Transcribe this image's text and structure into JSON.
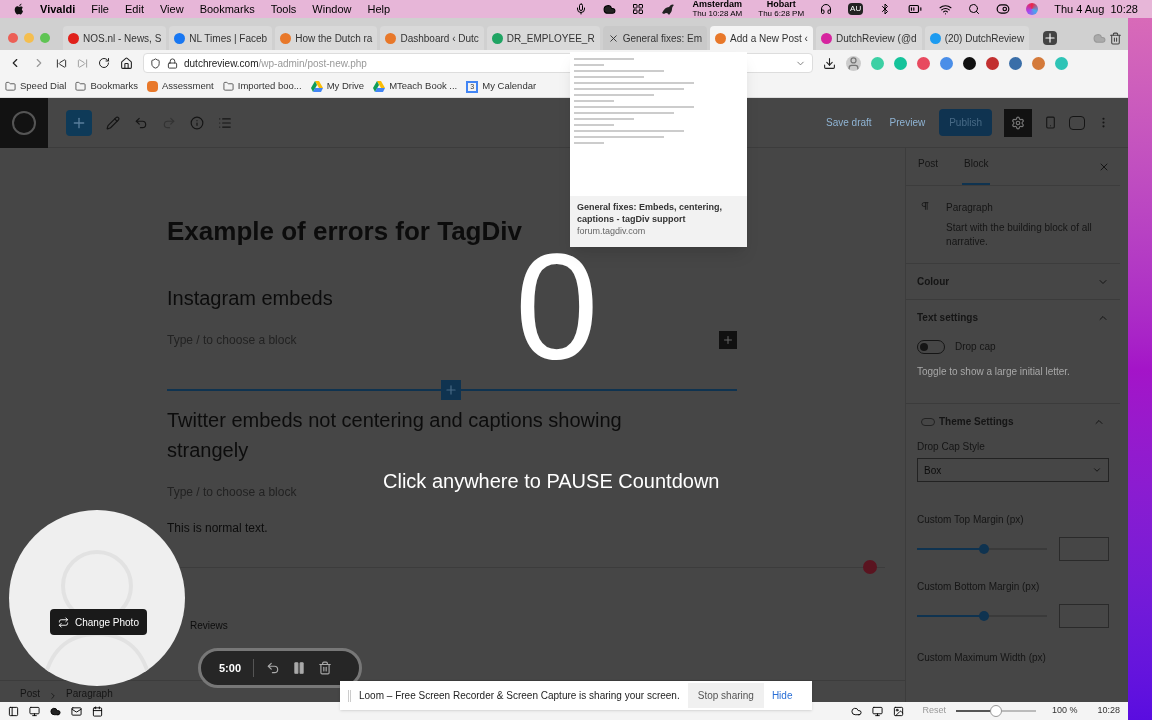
{
  "menu_bar": {
    "app": "Vivaldi",
    "items": [
      "File",
      "Edit",
      "View",
      "Bookmarks",
      "Tools",
      "Window",
      "Help"
    ],
    "clocks": [
      {
        "city": "Amsterdam",
        "time": "Thu 10:28 AM"
      },
      {
        "city": "Hobart",
        "time": "Thu 6:28 PM"
      }
    ],
    "input_source": "AU",
    "date": "Thu 4 Aug  10:28"
  },
  "tabs": [
    {
      "title": "NOS.nl - News, S",
      "selected": false,
      "hovered": false
    },
    {
      "title": "NL Times | Faceb",
      "selected": false,
      "hovered": false
    },
    {
      "title": "How the Dutch ra",
      "selected": false,
      "hovered": false
    },
    {
      "title": "Dashboard ‹ Dutc",
      "selected": false,
      "hovered": false
    },
    {
      "title": "DR_EMPLOYEE_R",
      "selected": false,
      "hovered": false
    },
    {
      "title": "General fixes: Em",
      "selected": false,
      "hovered": true
    },
    {
      "title": "Add a New Post ‹",
      "selected": true,
      "hovered": false
    },
    {
      "title": "DutchReview (@d",
      "selected": false,
      "hovered": false
    },
    {
      "title": "(20) DutchReview",
      "selected": false,
      "hovered": false
    }
  ],
  "address": {
    "host": "dutchreview.com",
    "path": "/wp-admin/post-new.php"
  },
  "bookmarks": [
    {
      "label": "Speed Dial",
      "kind": "folder"
    },
    {
      "label": "Bookmarks",
      "kind": "folder"
    },
    {
      "label": "Assessment",
      "kind": "site"
    },
    {
      "label": "Imported boo...",
      "kind": "folder"
    },
    {
      "label": "My Drive",
      "kind": "drive"
    },
    {
      "label": "MTeach Book ...",
      "kind": "drive"
    },
    {
      "label": "My Calendar",
      "kind": "calendar"
    }
  ],
  "calendar_day": "3",
  "wp_toolbar": {
    "save_draft": "Save draft",
    "preview": "Preview",
    "publish": "Publish"
  },
  "editor": {
    "title": "Example of errors for TagDiv",
    "blocks": [
      {
        "kind": "heading",
        "text": "Instagram embeds"
      },
      {
        "kind": "placeholder",
        "text": "Type / to choose a block"
      },
      {
        "kind": "heading",
        "text": "Twitter embeds not centering and captions showing strangely"
      },
      {
        "kind": "placeholder",
        "text": "Type / to choose a block"
      },
      {
        "kind": "paragraph",
        "text": "This is normal text."
      }
    ],
    "section_label": "Reviews",
    "breadcrumb": [
      "Post",
      "Paragraph"
    ]
  },
  "sidebar": {
    "tabs": [
      {
        "label": "Post",
        "selected": false
      },
      {
        "label": "Block",
        "selected": true
      }
    ],
    "block_name": "Paragraph",
    "block_description": "Start with the building block of all narrative.",
    "colour": {
      "label": "Colour",
      "expanded": false
    },
    "text_settings": {
      "label": "Text settings",
      "expanded": true,
      "drop_cap": {
        "label": "Drop cap",
        "on": false
      },
      "hint": "Toggle to show a large initial letter."
    },
    "theme_settings": {
      "label": "Theme Settings",
      "expanded": true,
      "drop_cap_style": {
        "label": "Drop Cap Style",
        "value": "Box"
      },
      "sliders": [
        {
          "label": "Custom Top Margin (px)",
          "level": 0.5
        },
        {
          "label": "Custom Bottom Margin (px)",
          "level": 0.5
        }
      ],
      "max_width_label": "Custom Maximum Width (px)"
    }
  },
  "overlay": {
    "countdown": "0",
    "message": "Click anywhere to PAUSE Countdown",
    "change_photo": "Change Photo",
    "timer": "5:00",
    "share_notice": "Loom – Free Screen Recorder & Screen Capture is sharing your screen.",
    "stop_sharing": "Stop sharing",
    "hide": "Hide"
  },
  "tab_preview": {
    "title": "General fixes: Embeds, centering, captions - tagDiv support",
    "url": "forum.tagdiv.com"
  },
  "status_bar": {
    "reset": "Reset",
    "zoom": {
      "level": 0.5
    },
    "zoom_text": "100 %",
    "time": "10:28"
  }
}
